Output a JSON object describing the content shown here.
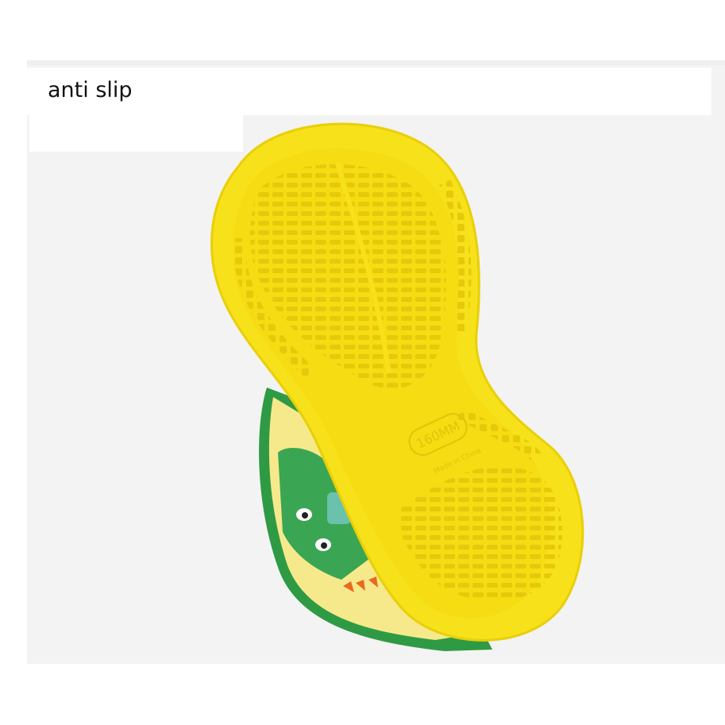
{
  "caption": "anti slip",
  "sole": {
    "size_mark": "160MM",
    "origin_mark": "Made in China"
  },
  "colors": {
    "sole": "#f7e11a",
    "sole_shade": "#e9cf08",
    "upper_green": "#2f9a44",
    "upper_yellow": "#f6e98c",
    "background": "#f3f3f3"
  }
}
